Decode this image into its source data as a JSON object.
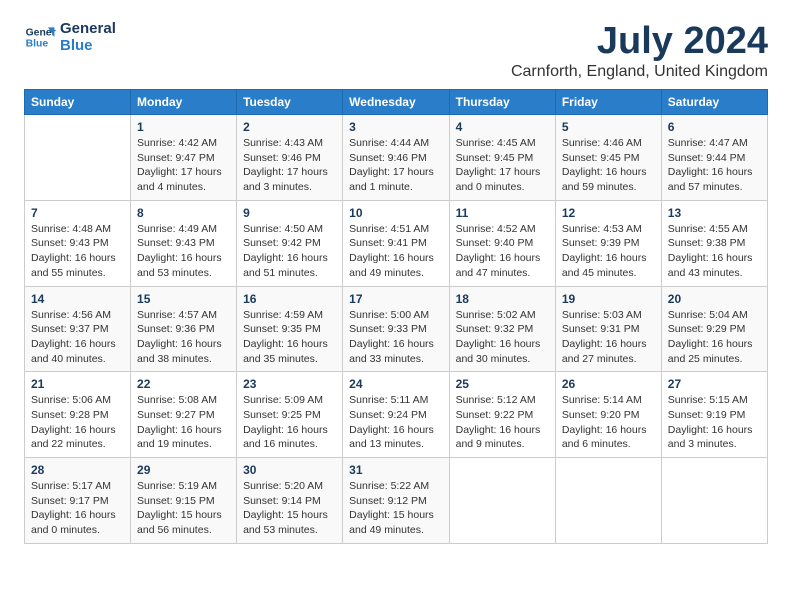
{
  "logo": {
    "line1": "General",
    "line2": "Blue"
  },
  "title": "July 2024",
  "location": "Carnforth, England, United Kingdom",
  "days_of_week": [
    "Sunday",
    "Monday",
    "Tuesday",
    "Wednesday",
    "Thursday",
    "Friday",
    "Saturday"
  ],
  "weeks": [
    [
      {
        "day": "",
        "info": ""
      },
      {
        "day": "1",
        "info": "Sunrise: 4:42 AM\nSunset: 9:47 PM\nDaylight: 17 hours\nand 4 minutes."
      },
      {
        "day": "2",
        "info": "Sunrise: 4:43 AM\nSunset: 9:46 PM\nDaylight: 17 hours\nand 3 minutes."
      },
      {
        "day": "3",
        "info": "Sunrise: 4:44 AM\nSunset: 9:46 PM\nDaylight: 17 hours\nand 1 minute."
      },
      {
        "day": "4",
        "info": "Sunrise: 4:45 AM\nSunset: 9:45 PM\nDaylight: 17 hours\nand 0 minutes."
      },
      {
        "day": "5",
        "info": "Sunrise: 4:46 AM\nSunset: 9:45 PM\nDaylight: 16 hours\nand 59 minutes."
      },
      {
        "day": "6",
        "info": "Sunrise: 4:47 AM\nSunset: 9:44 PM\nDaylight: 16 hours\nand 57 minutes."
      }
    ],
    [
      {
        "day": "7",
        "info": "Sunrise: 4:48 AM\nSunset: 9:43 PM\nDaylight: 16 hours\nand 55 minutes."
      },
      {
        "day": "8",
        "info": "Sunrise: 4:49 AM\nSunset: 9:43 PM\nDaylight: 16 hours\nand 53 minutes."
      },
      {
        "day": "9",
        "info": "Sunrise: 4:50 AM\nSunset: 9:42 PM\nDaylight: 16 hours\nand 51 minutes."
      },
      {
        "day": "10",
        "info": "Sunrise: 4:51 AM\nSunset: 9:41 PM\nDaylight: 16 hours\nand 49 minutes."
      },
      {
        "day": "11",
        "info": "Sunrise: 4:52 AM\nSunset: 9:40 PM\nDaylight: 16 hours\nand 47 minutes."
      },
      {
        "day": "12",
        "info": "Sunrise: 4:53 AM\nSunset: 9:39 PM\nDaylight: 16 hours\nand 45 minutes."
      },
      {
        "day": "13",
        "info": "Sunrise: 4:55 AM\nSunset: 9:38 PM\nDaylight: 16 hours\nand 43 minutes."
      }
    ],
    [
      {
        "day": "14",
        "info": "Sunrise: 4:56 AM\nSunset: 9:37 PM\nDaylight: 16 hours\nand 40 minutes."
      },
      {
        "day": "15",
        "info": "Sunrise: 4:57 AM\nSunset: 9:36 PM\nDaylight: 16 hours\nand 38 minutes."
      },
      {
        "day": "16",
        "info": "Sunrise: 4:59 AM\nSunset: 9:35 PM\nDaylight: 16 hours\nand 35 minutes."
      },
      {
        "day": "17",
        "info": "Sunrise: 5:00 AM\nSunset: 9:33 PM\nDaylight: 16 hours\nand 33 minutes."
      },
      {
        "day": "18",
        "info": "Sunrise: 5:02 AM\nSunset: 9:32 PM\nDaylight: 16 hours\nand 30 minutes."
      },
      {
        "day": "19",
        "info": "Sunrise: 5:03 AM\nSunset: 9:31 PM\nDaylight: 16 hours\nand 27 minutes."
      },
      {
        "day": "20",
        "info": "Sunrise: 5:04 AM\nSunset: 9:29 PM\nDaylight: 16 hours\nand 25 minutes."
      }
    ],
    [
      {
        "day": "21",
        "info": "Sunrise: 5:06 AM\nSunset: 9:28 PM\nDaylight: 16 hours\nand 22 minutes."
      },
      {
        "day": "22",
        "info": "Sunrise: 5:08 AM\nSunset: 9:27 PM\nDaylight: 16 hours\nand 19 minutes."
      },
      {
        "day": "23",
        "info": "Sunrise: 5:09 AM\nSunset: 9:25 PM\nDaylight: 16 hours\nand 16 minutes."
      },
      {
        "day": "24",
        "info": "Sunrise: 5:11 AM\nSunset: 9:24 PM\nDaylight: 16 hours\nand 13 minutes."
      },
      {
        "day": "25",
        "info": "Sunrise: 5:12 AM\nSunset: 9:22 PM\nDaylight: 16 hours\nand 9 minutes."
      },
      {
        "day": "26",
        "info": "Sunrise: 5:14 AM\nSunset: 9:20 PM\nDaylight: 16 hours\nand 6 minutes."
      },
      {
        "day": "27",
        "info": "Sunrise: 5:15 AM\nSunset: 9:19 PM\nDaylight: 16 hours\nand 3 minutes."
      }
    ],
    [
      {
        "day": "28",
        "info": "Sunrise: 5:17 AM\nSunset: 9:17 PM\nDaylight: 16 hours\nand 0 minutes."
      },
      {
        "day": "29",
        "info": "Sunrise: 5:19 AM\nSunset: 9:15 PM\nDaylight: 15 hours\nand 56 minutes."
      },
      {
        "day": "30",
        "info": "Sunrise: 5:20 AM\nSunset: 9:14 PM\nDaylight: 15 hours\nand 53 minutes."
      },
      {
        "day": "31",
        "info": "Sunrise: 5:22 AM\nSunset: 9:12 PM\nDaylight: 15 hours\nand 49 minutes."
      },
      {
        "day": "",
        "info": ""
      },
      {
        "day": "",
        "info": ""
      },
      {
        "day": "",
        "info": ""
      }
    ]
  ]
}
